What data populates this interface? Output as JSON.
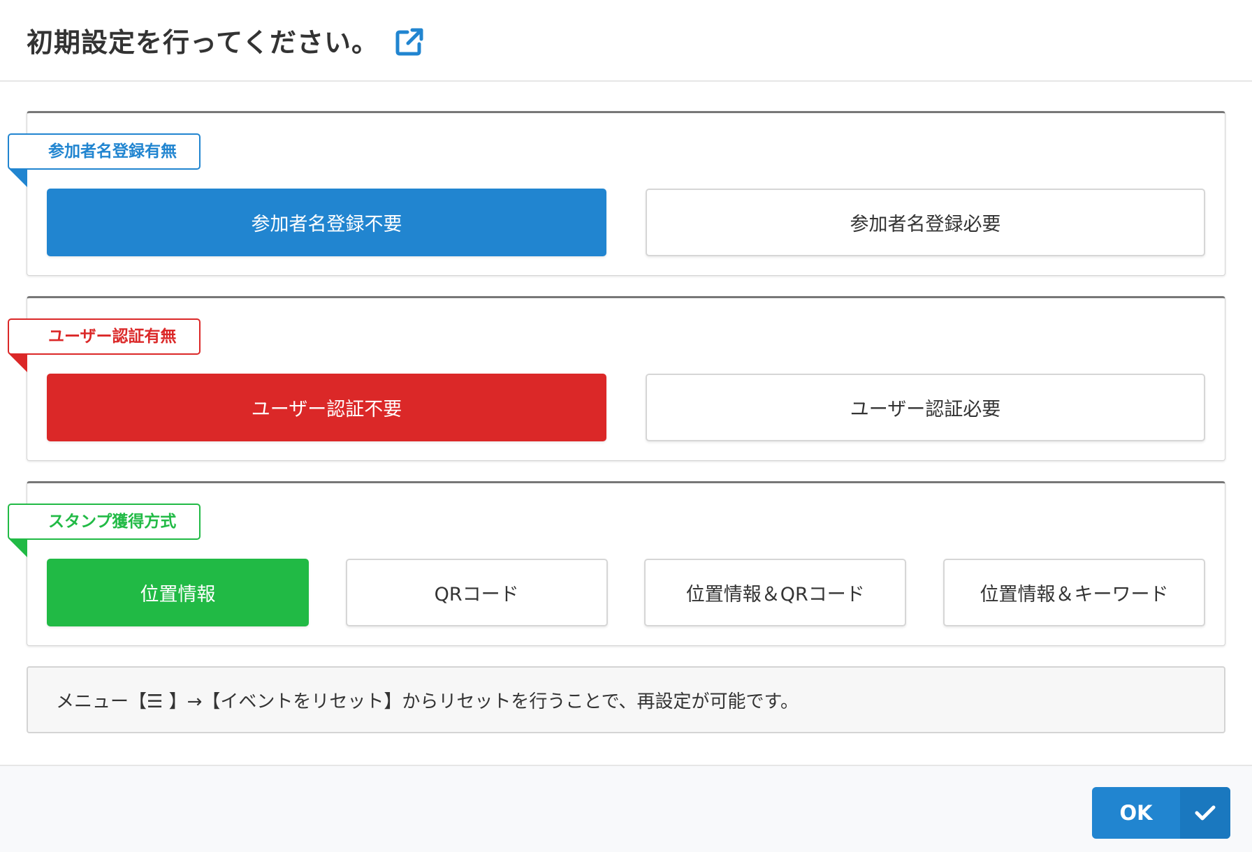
{
  "header": {
    "title": "初期設定を行ってください。",
    "link_icon": "external-link-icon"
  },
  "colors": {
    "blue": "#2185d0",
    "red": "#db2828",
    "green": "#21ba45"
  },
  "sections": [
    {
      "label": "参加者名登録有無",
      "color": "#2185d0",
      "options": [
        {
          "label": "参加者名登録不要",
          "selected": true
        },
        {
          "label": "参加者名登録必要",
          "selected": false
        }
      ]
    },
    {
      "label": "ユーザー認証有無",
      "color": "#db2828",
      "options": [
        {
          "label": "ユーザー認証不要",
          "selected": true
        },
        {
          "label": "ユーザー認証必要",
          "selected": false
        }
      ]
    },
    {
      "label": "スタンプ獲得方式",
      "color": "#21ba45",
      "options": [
        {
          "label": "位置情報",
          "selected": true
        },
        {
          "label": "QRコード",
          "selected": false
        },
        {
          "label": "位置情報＆QRコード",
          "selected": false
        },
        {
          "label": "位置情報＆キーワード",
          "selected": false
        }
      ]
    }
  ],
  "note": "メニュー【☰ 】→【イベントをリセット】からリセットを行うことで、再設定が可能です。",
  "footer": {
    "ok_label": "OK",
    "ok_icon": "checkmark-icon"
  }
}
